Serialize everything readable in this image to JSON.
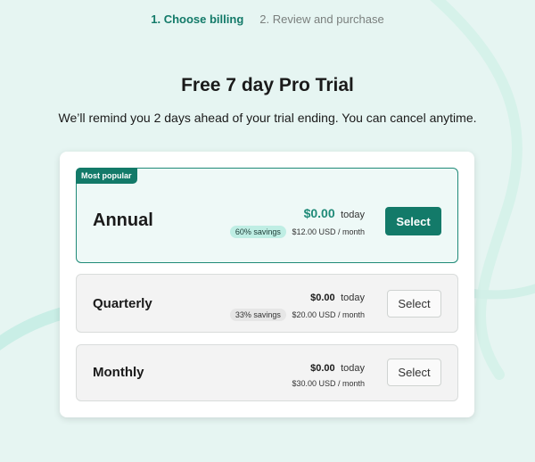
{
  "steps": [
    {
      "label": "1. Choose billing",
      "active": true
    },
    {
      "label": "2. Review and purchase",
      "active": false
    }
  ],
  "title": "Free 7 day Pro Trial",
  "subtitle": "We’ll remind you 2 days ahead of your trial ending. You can cancel anytime.",
  "plans": [
    {
      "name": "Annual",
      "badge": "Most popular",
      "price": "$0.00",
      "price_suffix": "today",
      "savings": "60% savings",
      "per_month": "$12.00 USD / month",
      "button_label": "Select",
      "selected": true
    },
    {
      "name": "Quarterly",
      "price": "$0.00",
      "price_suffix": "today",
      "savings": "33% savings",
      "per_month": "$20.00 USD / month",
      "button_label": "Select",
      "selected": false
    },
    {
      "name": "Monthly",
      "price": "$0.00",
      "price_suffix": "today",
      "per_month": "$30.00 USD / month",
      "button_label": "Select",
      "selected": false
    }
  ],
  "colors": {
    "accent": "#137a69",
    "accent_light": "#bfeee4",
    "background": "#e6f5f2"
  }
}
